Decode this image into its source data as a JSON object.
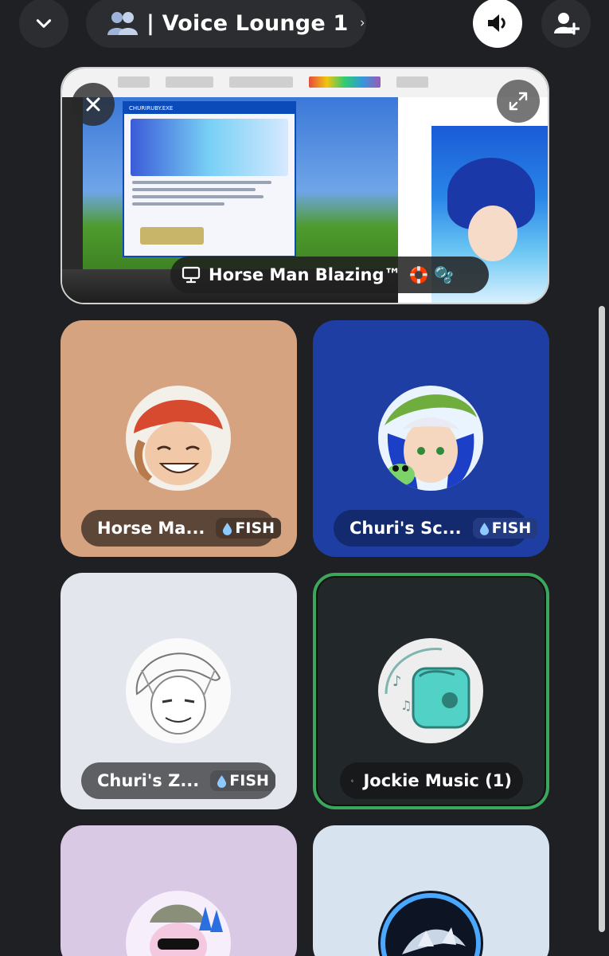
{
  "header": {
    "channel_title": "| Voice Lounge 1",
    "icons": {
      "collapse": "chevron-down-icon",
      "channel": "people-icon",
      "channel_nav": "chevron-right-icon",
      "speaker": "speaker-icon",
      "invite": "add-user-icon"
    }
  },
  "stream": {
    "label": "Horse Man Blazing™",
    "label_emojis": "🛟 🫧",
    "screen_window_title": "CHURIRUBY.EXE",
    "icons": {
      "close": "close-icon",
      "expand": "expand-icon",
      "screen": "monitor-icon"
    }
  },
  "participants": [
    {
      "name": "Horse Ma...",
      "tag": "FISH",
      "tile_color": "#d6a380"
    },
    {
      "name": "Churi's Sc...",
      "tag": "FISH",
      "tile_color": "#1f3ea3"
    },
    {
      "name": "Churi's Z...",
      "tag": "FISH",
      "tile_color": "#e4e6ee"
    },
    {
      "name": "Jockie Music (1)",
      "tag": "",
      "tile_color": "#22272a",
      "speaking": true,
      "speaking_color": "#3aa75c"
    },
    {
      "name": "",
      "tag": "",
      "tile_color": "#d9c9e4"
    },
    {
      "name": "",
      "tag": "",
      "tile_color": "#d7e3ef"
    }
  ]
}
